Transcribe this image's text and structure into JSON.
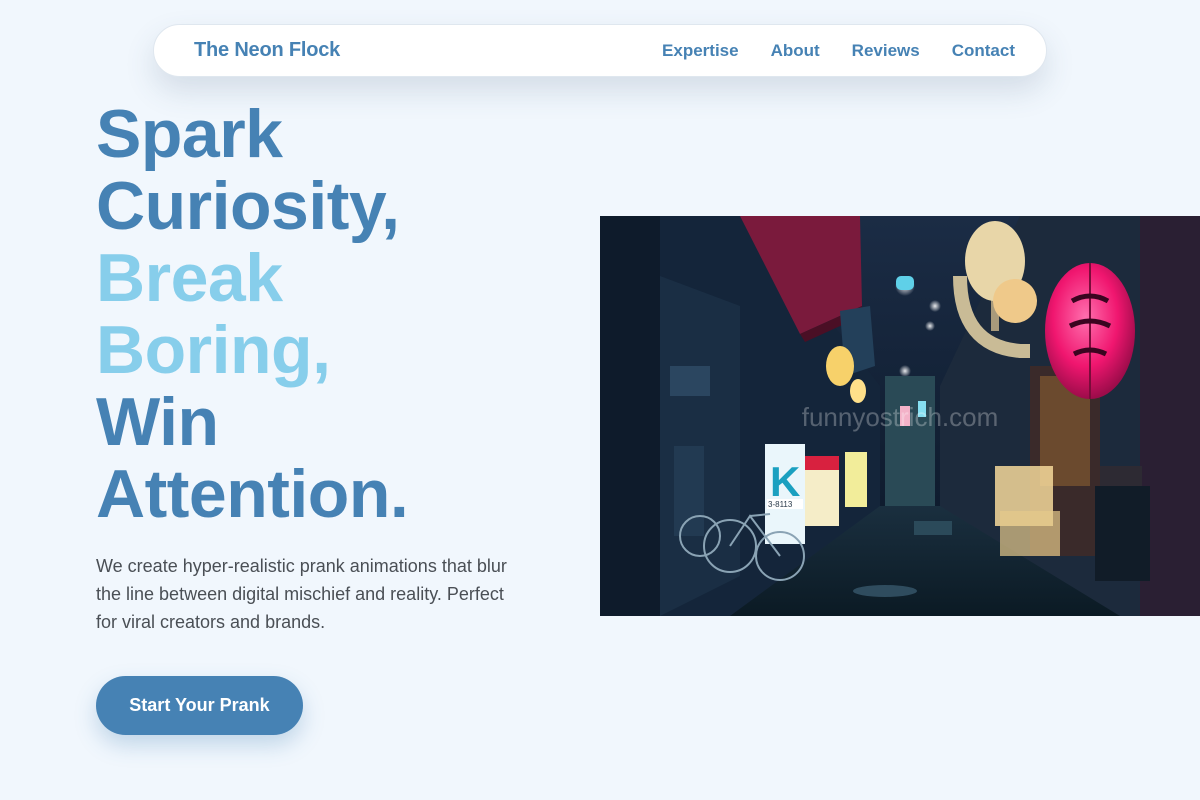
{
  "nav": {
    "brand": "The Neon Flock",
    "links": [
      {
        "label": "Expertise"
      },
      {
        "label": "About"
      },
      {
        "label": "Reviews"
      },
      {
        "label": "Contact"
      }
    ]
  },
  "hero": {
    "title_lines": [
      {
        "text": "Spark",
        "tone": "dark"
      },
      {
        "text": "Curiosity,",
        "tone": "dark"
      },
      {
        "text": "Break",
        "tone": "light"
      },
      {
        "text": "Boring,",
        "tone": "light"
      },
      {
        "text": "Win",
        "tone": "dark"
      },
      {
        "text": "Attention.",
        "tone": "dark"
      }
    ],
    "description": "We create hyper-realistic prank animations that blur the line between digital mischief and reality. Perfect for viral creators and brands.",
    "cta_label": "Start Your Prank",
    "image": {
      "watermark": "funnyostrich.com",
      "sign_k": "K",
      "sign_number": "3-8113"
    }
  },
  "colors": {
    "primary": "#4682b4",
    "accent": "#87ceeb",
    "background": "#f1f7fd",
    "text": "#4a4f55"
  }
}
